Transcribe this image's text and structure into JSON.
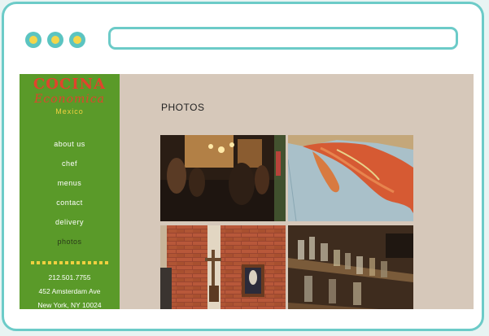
{
  "logo": {
    "line1": "COCINA",
    "line2": "Economica",
    "line3": "Mexico"
  },
  "nav": {
    "items": [
      "about us",
      "chef",
      "menus",
      "contact",
      "delivery",
      "photos"
    ],
    "active": "photos"
  },
  "contact": {
    "phone": "212.501.7755",
    "address1": "452 Amsterdam Ave",
    "address2": "New York, NY 10024"
  },
  "page": {
    "title": "PHOTOS"
  },
  "gallery": {
    "photos": [
      "restaurant-interior-photo",
      "mexico-map-photo",
      "brick-wall-altar-photo",
      "bottle-shelf-photo"
    ]
  },
  "colors": {
    "sidebar": "#5a9a29",
    "content_bg": "#d6c8ba",
    "logo_red": "#e0442c",
    "accent_yellow": "#f0d040",
    "frame": "#6ccbc8"
  }
}
